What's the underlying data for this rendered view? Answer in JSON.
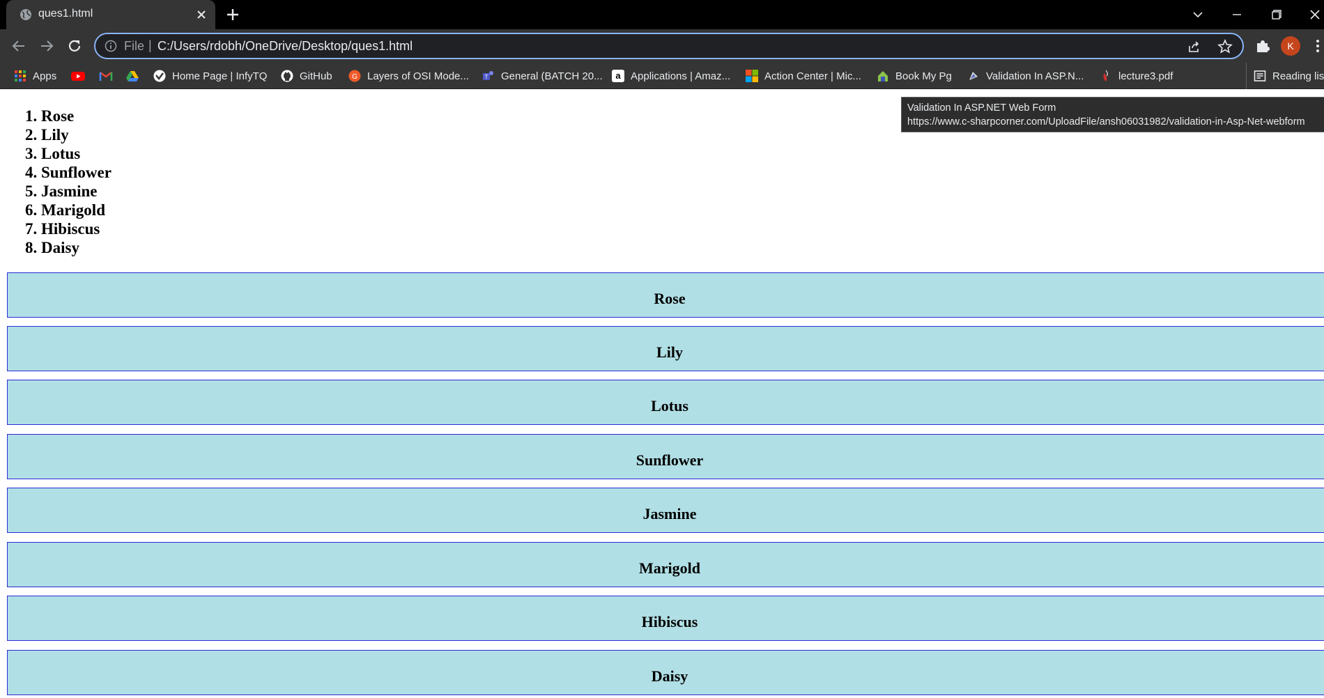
{
  "browser": {
    "tab": {
      "title": "ques1.html"
    },
    "address": {
      "scheme": "File",
      "url": "C:/Users/rdobh/OneDrive/Desktop/ques1.html"
    },
    "profile_initial": "K",
    "bookmarks": [
      {
        "label": "Apps",
        "icon": "apps-grid-icon"
      },
      {
        "label": "",
        "icon": "youtube-icon"
      },
      {
        "label": "",
        "icon": "gmail-icon"
      },
      {
        "label": "",
        "icon": "google-drive-icon"
      },
      {
        "label": "Home Page | InfyTQ",
        "icon": "infytq-icon"
      },
      {
        "label": "GitHub",
        "icon": "github-icon"
      },
      {
        "label": "Layers of OSI Mode...",
        "icon": "osi-site-icon"
      },
      {
        "label": "General (BATCH 20...",
        "icon": "teams-icon"
      },
      {
        "label": "Applications | Amaz...",
        "icon": "amazon-icon"
      },
      {
        "label": "Action Center | Mic...",
        "icon": "microsoft-icon"
      },
      {
        "label": "Book My Pg",
        "icon": "bookmypg-icon"
      },
      {
        "label": "Validation In ASP.N...",
        "icon": "csharpcorner-icon"
      },
      {
        "label": "lecture3.pdf",
        "icon": "pdf-icon"
      },
      {
        "label": "Reading list",
        "icon": "reading-list-icon"
      }
    ],
    "tooltip": {
      "title": "Validation In ASP.NET Web Form",
      "url": "https://www.c-sharpcorner.com/UploadFile/ansh06031982/validation-in-Asp-Net-webform"
    }
  },
  "page": {
    "list_items": [
      {
        "num": "1.",
        "name": "Rose"
      },
      {
        "num": "2.",
        "name": "Lily"
      },
      {
        "num": "3.",
        "name": "Lotus"
      },
      {
        "num": "4.",
        "name": "Sunflower"
      },
      {
        "num": "5.",
        "name": "Jasmine"
      },
      {
        "num": "6.",
        "name": "Marigold"
      },
      {
        "num": "7.",
        "name": "Hibiscus"
      },
      {
        "num": "8.",
        "name": "Daisy"
      }
    ],
    "boxes": [
      "Rose",
      "Lily",
      "Lotus",
      "Sunflower",
      "Jasmine",
      "Marigold",
      "Hibiscus",
      "Daisy"
    ]
  },
  "colors": {
    "box_fill": "#b0dfe5",
    "box_border": "#2b2bd6",
    "omnibox_focus": "#8ab4f8",
    "profile_avatar": "#c5451c"
  }
}
